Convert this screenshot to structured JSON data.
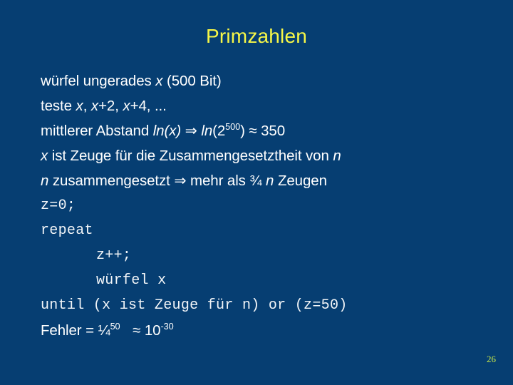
{
  "slide": {
    "title": "Primzahlen",
    "background_color": "#063e72",
    "title_color": "#f7f747",
    "body_color": "#ffffff",
    "page_number_color": "#c8e84a",
    "page_number": "26"
  },
  "lines": {
    "l1_a": "würfel ungerades ",
    "l1_x": "x",
    "l1_b": " (500 Bit)",
    "l2_a": "teste ",
    "l2_x1": "x",
    "l2_b": ", ",
    "l2_x2": "x",
    "l2_c": "+2, ",
    "l2_x3": "x",
    "l2_d": "+4, ...",
    "l3_a": "mittlerer Abstand ",
    "l3_ln1": "ln(x)",
    "l3_arrow": " ⇒ ",
    "l3_ln2": "ln",
    "l3_b": "(2",
    "l3_sup": "500",
    "l3_c": ") ≈ 350",
    "l4_x": "x",
    "l4_a": " ist Zeuge für die Zusammengesetztheit von ",
    "l4_n": "n",
    "l5_n1": "n",
    "l5_a": " zusammengesetzt ⇒ mehr als ¾ ",
    "l5_n2": "n",
    "l5_b": " Zeugen",
    "code1": "z=0;",
    "code2": "repeat",
    "code3": "z++;",
    "code4": "würfel x",
    "code5": "until (x ist Zeuge für n) or (z=50)",
    "l6_a": "Fehler = ¼",
    "l6_sup1": "50",
    "l6_b": " ≈ 10",
    "l6_sup2": "-30"
  }
}
